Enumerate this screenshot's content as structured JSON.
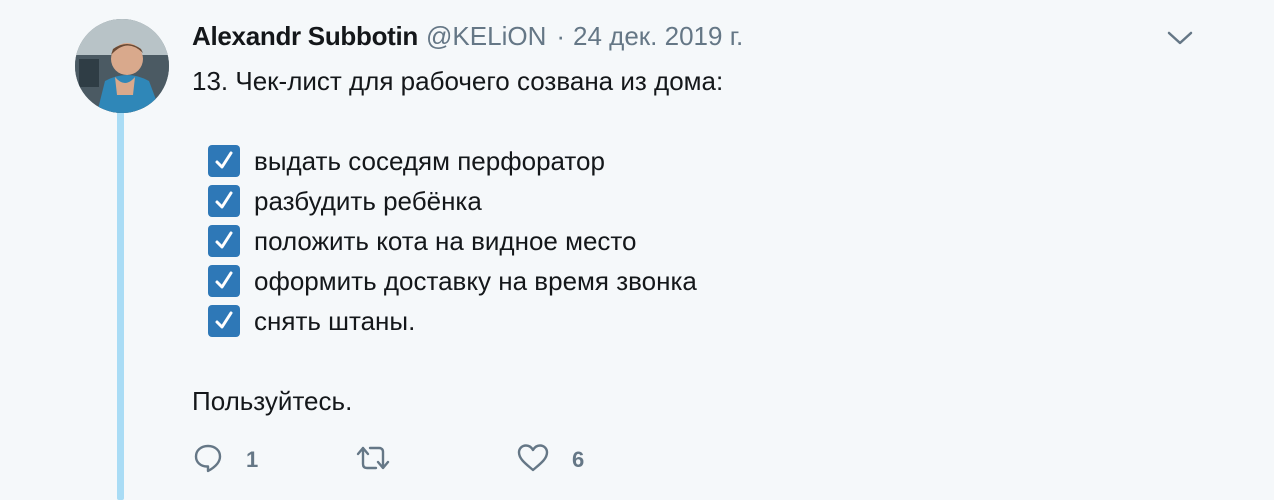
{
  "tweet": {
    "author_name": "Alexandr Subbotin",
    "handle": "@KELiON",
    "separator": "·",
    "date": "24 дек. 2019 г.",
    "intro": "13. Чек-лист для рабочего созвана из дома:",
    "checklist": [
      "выдать соседям перфоратор",
      "разбудить ребёнка",
      "положить кота на видное место",
      "оформить доставку на время звонка",
      "снять штаны."
    ],
    "outro": "Пользуйтесь."
  },
  "actions": {
    "reply_count": "1",
    "retweet_count": "",
    "like_count": "6"
  },
  "icons": {
    "caret": "chevron-down-icon",
    "check": "checkbox-checked-icon",
    "reply": "reply-icon",
    "retweet": "retweet-icon",
    "like": "heart-icon"
  },
  "colors": {
    "background": "#f5f8fa",
    "thread_line": "#a9dcf5",
    "secondary_text": "#657786",
    "checkbox": "#2e78b7"
  }
}
